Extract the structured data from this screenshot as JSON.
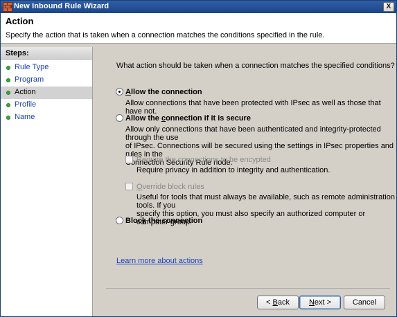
{
  "window": {
    "title": "New Inbound Rule Wizard",
    "close_symbol": "X"
  },
  "header": {
    "title": "Action",
    "description": "Specify the action that is taken when a connection matches the conditions specified in the rule."
  },
  "steps": {
    "heading": "Steps:",
    "items": [
      {
        "label": "Rule Type",
        "current": false
      },
      {
        "label": "Program",
        "current": false
      },
      {
        "label": "Action",
        "current": true
      },
      {
        "label": "Profile",
        "current": false
      },
      {
        "label": "Name",
        "current": false
      }
    ]
  },
  "content": {
    "question": "What action should be taken when a connection matches the specified conditions?",
    "options": {
      "allow": {
        "label_pre": "",
        "label_u": "A",
        "label_post": "llow the connection",
        "selected": true,
        "description": "Allow connections that have been protected with IPsec as well as those that have not."
      },
      "allow_secure": {
        "label_pre": "Allow the ",
        "label_u": "c",
        "label_post": "onnection if it is secure",
        "selected": false,
        "description_lines": [
          "Allow only connections that have been authenticated and integrity-protected through the use",
          "of IPsec.  Connections will be secured using the settings in IPsec properties and rules in the",
          "Connection Security Rule node."
        ]
      },
      "require_encryption": {
        "label_pre": "",
        "label_u": "R",
        "label_post": "equire the connections to be encypted",
        "checked": false,
        "enabled": false,
        "description": "Require privacy in addition to integrity and authentication."
      },
      "override_block": {
        "label_pre": "",
        "label_u": "O",
        "label_post": "verride block rules",
        "checked": false,
        "enabled": false,
        "description_lines": [
          "Useful for tools that must always be available, such as remote administration tools.  If you",
          "specify this option, you must also specify an authorized computer or computer group."
        ]
      },
      "block": {
        "label_pre": "Bloc",
        "label_u": "k",
        "label_post": " the connection",
        "selected": false
      }
    },
    "learn_more": "Learn more about actions"
  },
  "buttons": {
    "back": {
      "pre": "< ",
      "u": "B",
      "post": "ack"
    },
    "next": {
      "pre": "",
      "u": "N",
      "post": "ext >"
    },
    "cancel": {
      "label": "Cancel"
    }
  },
  "colors": {
    "titlebar": "#1d4486",
    "link": "#1c43c1",
    "step_dot": "#3ea63e"
  }
}
